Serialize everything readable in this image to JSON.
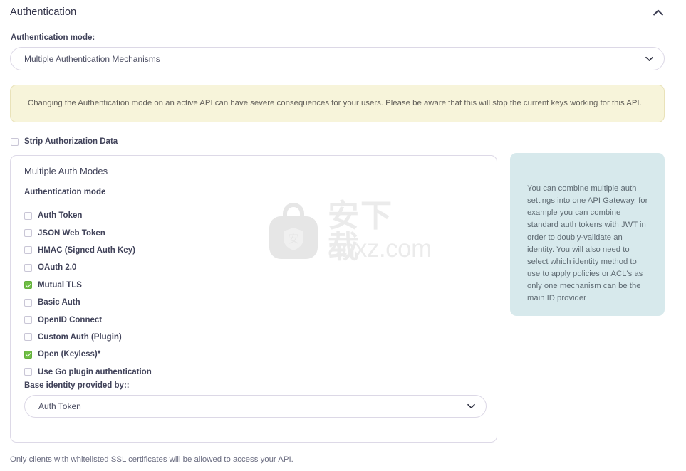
{
  "section": {
    "title": "Authentication",
    "collapse_icon": "chevron-up-icon"
  },
  "auth_mode": {
    "label": "Authentication mode:",
    "selected": "Multiple Authentication Mechanisms",
    "caret_icon": "chevron-down-icon",
    "options": [
      "Multiple Authentication Mechanisms"
    ]
  },
  "warning": {
    "text": "Changing the Authentication mode on an active API can have severe consequences for your users. Please be aware that this will stop the current keys working for this API.",
    "bg_color": "#f7f4da",
    "border_color": "#e9e2b9"
  },
  "strip_authorization": {
    "label": "Strip Authorization Data",
    "checked": false
  },
  "multi_auth_card": {
    "title": "Multiple Auth Modes",
    "subtitle": "Authentication mode",
    "modes": [
      {
        "label": "Auth Token",
        "checked": false
      },
      {
        "label": "JSON Web Token",
        "checked": false
      },
      {
        "label": "HMAC (Signed Auth Key)",
        "checked": false
      },
      {
        "label": "OAuth 2.0",
        "checked": false
      },
      {
        "label": "Mutual TLS",
        "checked": true
      },
      {
        "label": "Basic Auth",
        "checked": false
      },
      {
        "label": "OpenID Connect",
        "checked": false
      },
      {
        "label": "Custom Auth (Plugin)",
        "checked": false
      },
      {
        "label": "Open (Keyless)*",
        "checked": true
      },
      {
        "label": "Use Go plugin authentication",
        "checked": false
      }
    ],
    "base_identity": {
      "label": "Base identity provided by::",
      "selected": "Auth Token",
      "caret_icon": "chevron-down-icon",
      "options": [
        "Auth Token"
      ]
    },
    "checked_color": "#6fbe44"
  },
  "info_box": {
    "text": "You can combine multiple auth settings into one API Gateway, for example you can combine standard auth tokens with JWT in order to doubly-validate an identity. You will also need to select which identity method to use to apply policies or ACL's as only one mechanism can be the main ID provider",
    "bg_color": "#d7e9ec"
  },
  "footer": {
    "note": "Only clients with whitelisted SSL certificates will be allowed to access your API."
  },
  "watermark": {
    "badge_icon": "shield-bag-icon",
    "text_zh": "安下载",
    "text_en": "anxz.com"
  }
}
